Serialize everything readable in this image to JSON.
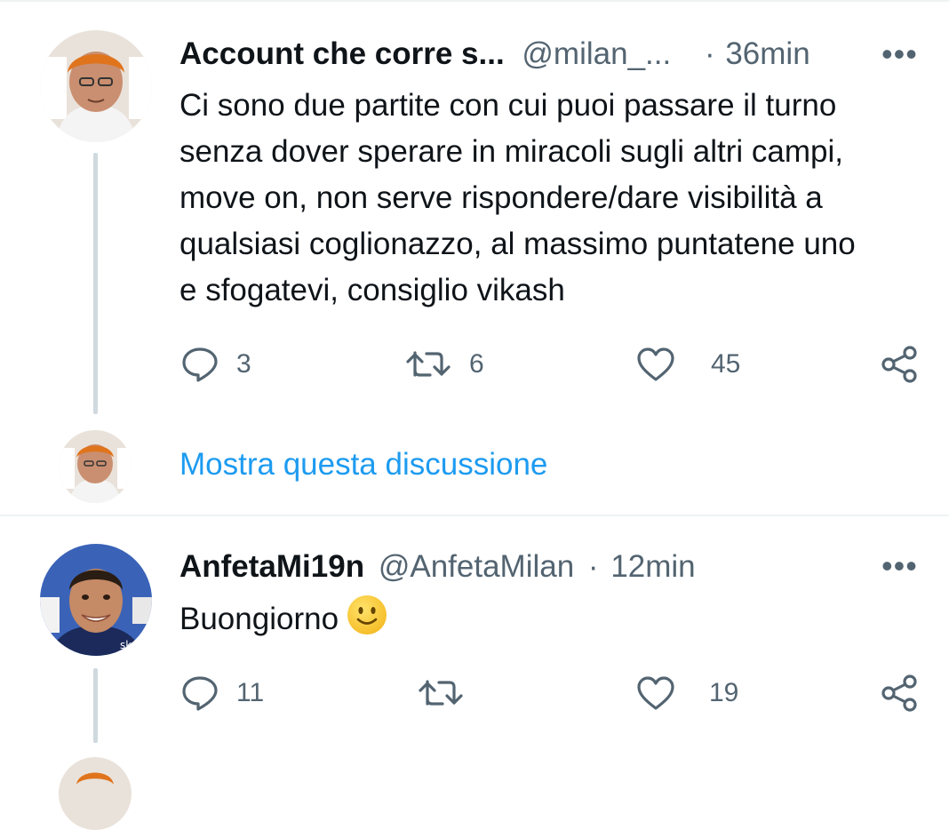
{
  "tweets": [
    {
      "name": "Account che corre s...",
      "handle": "@milan_...",
      "sep": "·",
      "time": "36min",
      "more": "•••",
      "lines": [
        "Ci sono due partite con cui puoi passare il turno",
        "senza dover sperare in miracoli sugli altri campi,",
        "move on, non serve rispondere/dare visibilità a",
        "qualsiasi coglionazzo, al massimo puntatene uno",
        "e sfogatevi, consiglio vikash"
      ],
      "actions": {
        "reply": "3",
        "retweet": "6",
        "like": "45"
      }
    },
    {
      "name": "AnfetaMi19n",
      "handle": "@AnfetaMilan",
      "sep": "·",
      "time": "12min",
      "more": "•••",
      "text": "Buongiorno",
      "emoji": "slightly-smiling-face-emoji",
      "actions": {
        "reply": "11",
        "retweet": "",
        "like": "19"
      }
    }
  ],
  "show_thread": "Mostra questa discussione",
  "icons": {
    "reply": "reply-icon",
    "retweet": "retweet-icon",
    "like": "heart-icon",
    "share": "share-icon",
    "more": "more-icon"
  },
  "colors": {
    "link": "#1d9bf0",
    "muted": "#536471",
    "text": "#0f1419",
    "thread_line": "#cfd9de",
    "divider": "#eff3f4"
  }
}
